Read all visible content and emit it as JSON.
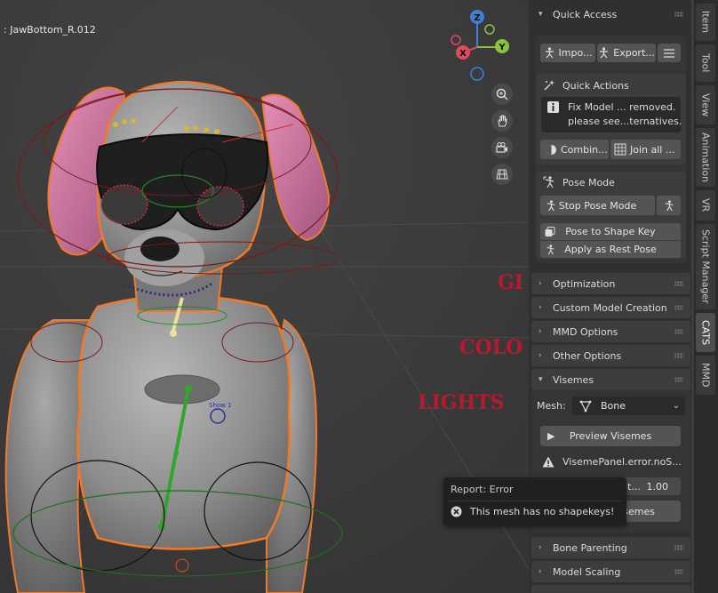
{
  "viewport": {
    "active_object": ": JawBottom_R.012",
    "gizmo": {
      "z": "Z",
      "y": "Y",
      "x": "X"
    },
    "scene_texts": [
      "GI",
      "COLO",
      "LIGHTS"
    ],
    "model_marking": "Show 1"
  },
  "tabs": [
    "Item",
    "Tool",
    "View",
    "Animation",
    "VR",
    "Script Manager",
    "CATS",
    "MMD"
  ],
  "active_tab": "CATS",
  "panels": {
    "quick_access": {
      "title": "Quick Access",
      "import_label": "Impo...",
      "export_label": "Export...",
      "quick_actions": {
        "title": "Quick Actions",
        "message_line1": "Fix Model ... removed.",
        "message_line2": "please see...ternatives.",
        "combine_label": "Combin...",
        "join_label": "Join all ..."
      },
      "pose_mode": {
        "title": "Pose Mode",
        "stop_label": "Stop Pose Mode",
        "to_shape_label": "Pose to Shape Key",
        "apply_rest_label": "Apply as Rest Pose"
      }
    },
    "optimization": "Optimization",
    "custom_model": "Custom Model Creation",
    "mmd_options": "MMD Options",
    "other_options": "Other Options",
    "visemes": {
      "title": "Visemes",
      "mesh_label": "Mesh:",
      "mesh_value": "Bone",
      "preview_label": "Preview Visemes",
      "error_text": "VisemePanel.error.noS...",
      "partial_field": "t...",
      "field_value": "1.00",
      "partial_button": "semes"
    },
    "bone_parenting": "Bone Parenting",
    "model_scaling": "Model Scaling"
  },
  "report": {
    "title": "Report: Error",
    "message": "This mesh has no shapekeys!"
  },
  "colors": {
    "accent": "#f08a24",
    "panel_bg": "#303030",
    "button": "#545454",
    "viewport": "#3d3d3d"
  }
}
